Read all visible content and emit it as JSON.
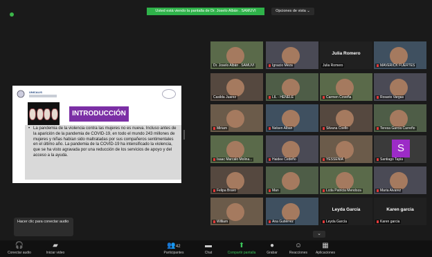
{
  "top": {
    "banner": "Usted está viendo la pantalla de Dr. Joselo Albán . SAMUVI",
    "view_options": "Opciones de vista ⌄"
  },
  "slide": {
    "brand": "UNICALIS",
    "title": "INTRODUCCIÓN",
    "body": "La pandemia de la violencia contra las mujeres no es nueva. Incluso antes de la aparición de la pandemia de COVID-19, en todo el mundo 243 millones de mujeres y niñas habían sido maltratadas por sus compañeros sentimentales en el último año. La pandemia de la COVID-19 ha intensificado la violencia, que se ha visto agravada por una reducción de los servicios de apoyo y del acceso a la ayuda."
  },
  "participants": [
    {
      "label": "Dr. Joselo Albán . SAMUVI",
      "mic": false,
      "type": "video",
      "active": true
    },
    {
      "label": "Ignacio Meza",
      "mic": true,
      "type": "video"
    },
    {
      "label": "Julia Romero",
      "mic": false,
      "type": "name",
      "center": "Julia Romero"
    },
    {
      "label": "MAVERICK FUERTES",
      "mic": true,
      "type": "video"
    },
    {
      "label": "Casilda Juarez",
      "mic": false,
      "type": "video"
    },
    {
      "label": "LIL - HENELE",
      "mic": true,
      "type": "video"
    },
    {
      "label": "Carmen Coveña",
      "mic": true,
      "type": "video"
    },
    {
      "label": "Rosario Vargas",
      "mic": true,
      "type": "video"
    },
    {
      "label": "Miriam",
      "mic": true,
      "type": "video"
    },
    {
      "label": "Nelsen Alban",
      "mic": true,
      "type": "video"
    },
    {
      "label": "Silvana Coello",
      "mic": true,
      "type": "video"
    },
    {
      "label": "Teresa Garcia Carreño",
      "mic": true,
      "type": "video"
    },
    {
      "label": "Isaac Marcalo Molina...",
      "mic": true,
      "type": "video"
    },
    {
      "label": "Haidee Cedeño",
      "mic": true,
      "type": "video"
    },
    {
      "label": "YESSENIA",
      "mic": true,
      "type": "video"
    },
    {
      "label": "Santiago Tapia",
      "mic": true,
      "type": "avatar",
      "letter": "S"
    },
    {
      "label": "Felipa Bravo",
      "mic": true,
      "type": "video"
    },
    {
      "label": "Man",
      "mic": true,
      "type": "video"
    },
    {
      "label": "Lcda Patricia Mendoza",
      "mic": true,
      "type": "video"
    },
    {
      "label": "Maria Alvarez",
      "mic": true,
      "type": "video"
    },
    {
      "label": "William",
      "mic": true,
      "type": "video"
    },
    {
      "label": "Ana Gutiérrez",
      "mic": true,
      "type": "video"
    },
    {
      "label": "Leyda García",
      "mic": true,
      "type": "name",
      "center": "Leyda García"
    },
    {
      "label": "Karen garcia",
      "mic": true,
      "type": "name",
      "center": "Karen garcia"
    }
  ],
  "tooltip": "Hacer clic para conectar audio",
  "toolbar": {
    "audio": "Conectar audio",
    "video": "Iniciar video",
    "participants": "Participantes",
    "participants_count": "42",
    "chat": "Chat",
    "share": "Compartir pantalla",
    "record": "Grabar",
    "reactions": "Reacciones",
    "apps": "Aplicaciones",
    "more": "⌄"
  },
  "colors": {
    "banner": "#2fb24a",
    "intro": "#7b2fa5",
    "avatar": "#9c2bc7",
    "active_outline": "#8fd14f"
  }
}
